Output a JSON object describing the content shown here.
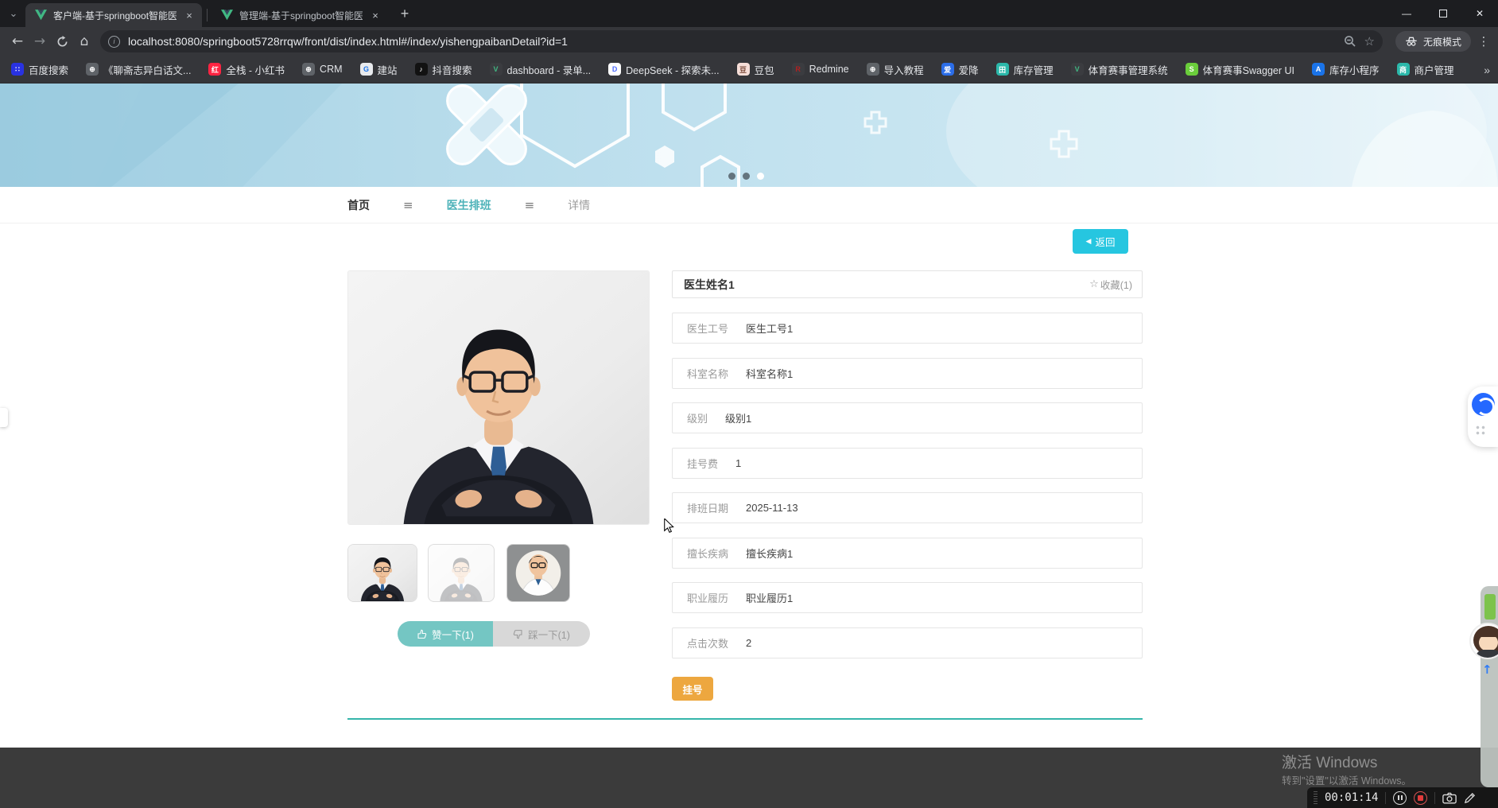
{
  "theme": {
    "accent_teal": "#4CB2B8",
    "button_cyan": "#26C6E0",
    "button_orange": "#EDA73F",
    "like_teal": "#74C6C3",
    "divider_teal": "#35B5AB"
  },
  "icons": {
    "tab_chevron": "⌄",
    "tab_close": "×",
    "new_tab": "+",
    "minimize": "—",
    "close_window": "✕",
    "back": "←",
    "forward": "→",
    "home": "⌂",
    "info": "i",
    "star": "☆",
    "menu": "⋮",
    "overflow": "»",
    "up_arrow": "↑"
  },
  "browser": {
    "tabs": [
      {
        "title": "客户端-基于springboot智能医"
      },
      {
        "title": "管理端-基于springboot智能医"
      }
    ],
    "url": "localhost:8080/springboot5728rrqw/front/dist/index.html#/index/yishengpaibanDetail?id=1",
    "incognito_label": "无痕模式",
    "bookmarks": [
      {
        "label": "百度搜索",
        "color": "#2932E1",
        "fg": "#FFFFFF",
        "glyph": "∷"
      },
      {
        "label": "《聊斋志异白话文...",
        "color": "#5F6368",
        "fg": "#FFFFFF",
        "glyph": "⊕"
      },
      {
        "label": "全栈 - 小红书",
        "color": "#FF2442",
        "fg": "#FFFFFF",
        "glyph": "红"
      },
      {
        "label": "CRM",
        "color": "#5F6368",
        "fg": "#FFFFFF",
        "glyph": "⊕"
      },
      {
        "label": "建站",
        "color": "#E8EAED",
        "fg": "#1A73E8",
        "glyph": "G"
      },
      {
        "label": "抖音搜索",
        "color": "#121212",
        "fg": "#FFFFFF",
        "glyph": "♪"
      },
      {
        "label": "dashboard - 录单...",
        "color": "#3B3C40",
        "fg": "#41B883",
        "glyph": "V"
      },
      {
        "label": "DeepSeek - 探索未...",
        "color": "#FFFFFF",
        "fg": "#4D6BFE",
        "glyph": "D"
      },
      {
        "label": "豆包",
        "color": "#F6DED8",
        "fg": "#7A4A3A",
        "glyph": "豆"
      },
      {
        "label": "Redmine",
        "color": "#3B3C40",
        "fg": "#B02121",
        "glyph": "R"
      },
      {
        "label": "导入教程",
        "color": "#5F6368",
        "fg": "#FFFFFF",
        "glyph": "⊕"
      },
      {
        "label": "爱降",
        "color": "#2B6DE8",
        "fg": "#FFFFFF",
        "glyph": "爱"
      },
      {
        "label": "库存管理",
        "color": "#2BB8AA",
        "fg": "#FFFFFF",
        "glyph": "田"
      },
      {
        "label": "体育赛事管理系统",
        "color": "#3B3C40",
        "fg": "#41B883",
        "glyph": "V"
      },
      {
        "label": "体育赛事Swagger UI",
        "color": "#6ACE3B",
        "fg": "#FFFFFF",
        "glyph": "S"
      },
      {
        "label": "库存小程序",
        "color": "#1A73E8",
        "fg": "#FFFFFF",
        "glyph": "A"
      },
      {
        "label": "商户管理",
        "color": "#2BB8AA",
        "fg": "#FFFFFF",
        "glyph": "商"
      }
    ]
  },
  "nav": {
    "home": "首页",
    "schedule": "医生排班",
    "detail": "详情",
    "separator_icon": "≡"
  },
  "detail": {
    "back_arrow": "◀",
    "back_label": "返回",
    "doctor_name": "医生姓名1",
    "favorite_star": "☆",
    "favorite_label": "收藏(1)",
    "fields": [
      {
        "label": "医生工号",
        "value": "医生工号1"
      },
      {
        "label": "科室名称",
        "value": "科室名称1"
      },
      {
        "label": "级别",
        "value": "级别1"
      },
      {
        "label": "挂号费",
        "value": "1"
      },
      {
        "label": "排班日期",
        "value": "2025-11-13"
      },
      {
        "label": "擅长疾病",
        "value": "擅长疾病1"
      },
      {
        "label": "职业履历",
        "value": "职业履历1"
      },
      {
        "label": "点击次数",
        "value": "2"
      }
    ],
    "register_label": "挂号",
    "like_label": "赞一下(1)",
    "dislike_label": "踩一下(1)"
  },
  "windows_watermark": {
    "line1": "激活 Windows",
    "line2": "转到\"设置\"以激活 Windows。"
  },
  "recorder": {
    "time": "00:01:14"
  }
}
